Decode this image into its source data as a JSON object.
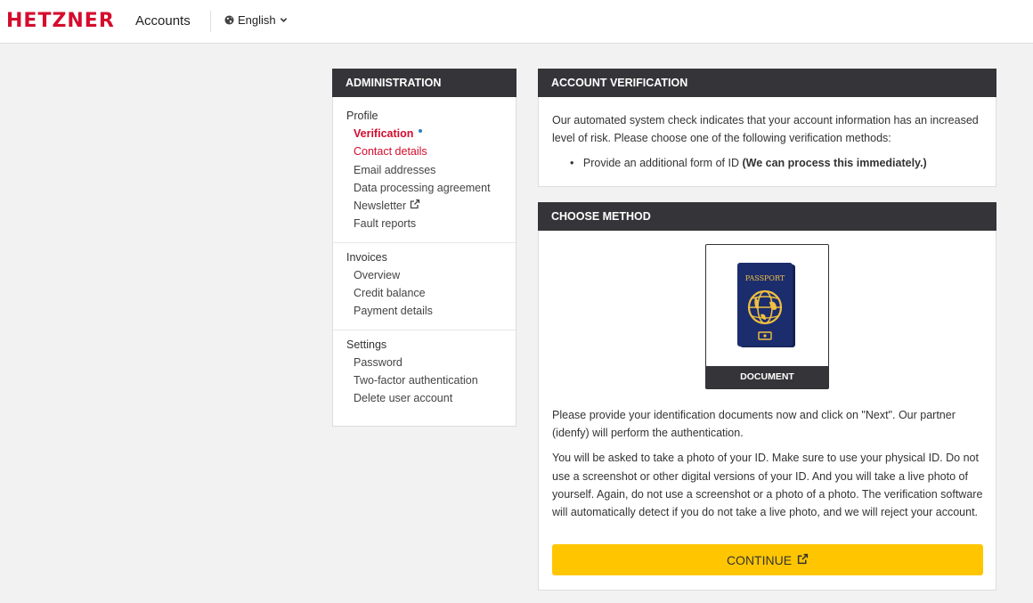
{
  "header": {
    "logo": "HETZNER",
    "app_name": "Accounts",
    "language": "English"
  },
  "sidebar": {
    "title": "ADMINISTRATION",
    "groups": [
      {
        "title": "Profile",
        "items": [
          {
            "label": "Verification"
          },
          {
            "label": "Contact details"
          },
          {
            "label": "Email addresses"
          },
          {
            "label": "Data processing agreement"
          },
          {
            "label": "Newsletter"
          },
          {
            "label": "Fault reports"
          }
        ]
      },
      {
        "title": "Invoices",
        "items": [
          {
            "label": "Overview"
          },
          {
            "label": "Credit balance"
          },
          {
            "label": "Payment details"
          }
        ]
      },
      {
        "title": "Settings",
        "items": [
          {
            "label": "Password"
          },
          {
            "label": "Two-factor authentication"
          },
          {
            "label": "Delete user account"
          }
        ]
      }
    ]
  },
  "verification": {
    "title": "ACCOUNT VERIFICATION",
    "text": "Our automated system check indicates that your account information has an increased level of risk. Please choose one of the following verification methods:",
    "option_text": "Provide an additional form of ID",
    "option_note": "(We can process this immediately.)"
  },
  "method": {
    "title": "CHOOSE METHOD",
    "card_label": "DOCUMENT",
    "passport_text": "PASSPORT",
    "paragraph1": "Please provide your identification documents now and click on \"Next\". Our partner (idenfy) will perform the authentication.",
    "paragraph2": "You will be asked to take a photo of your ID. Make sure to use your physical ID. Do not use a screenshot or other digital versions of your ID. And you will take a live photo of yourself. Again, do not use a screenshot or a photo of a photo. The verification software will automatically detect if you do not take a live photo, and we will reject your account.",
    "continue_label": "CONTINUE"
  },
  "colors": {
    "brand_red": "#d50c2d",
    "header_dark": "#353438",
    "button_yellow": "#ffc600",
    "passport_blue": "#1c2d6e",
    "passport_gold": "#f0c040"
  }
}
